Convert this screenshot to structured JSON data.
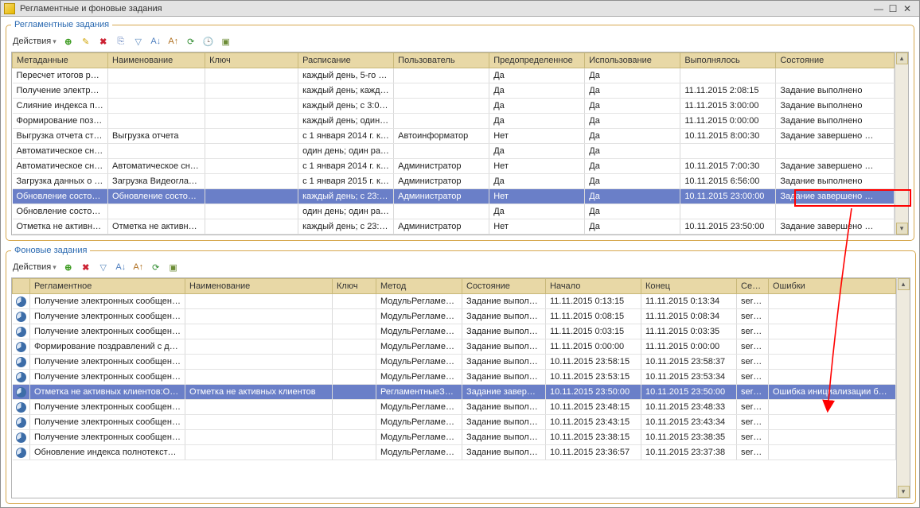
{
  "window": {
    "title": "Регламентные и фоновые задания"
  },
  "panel1": {
    "legend": "Регламентные задания",
    "actions_label": "Действия",
    "headers": [
      "Метаданные",
      "Наименование",
      "Ключ",
      "Расписание",
      "Пользователь",
      "Предопределенное",
      "Использование",
      "Выполнялось",
      "Состояние"
    ],
    "rows": [
      {
        "c": [
          "Пересчет итогов ре…",
          "",
          "",
          "каждый  день, 5-го ч…",
          "",
          "Да",
          "Да",
          "",
          ""
        ]
      },
      {
        "c": [
          "Получение электро…",
          "",
          "",
          "каждый  день; кажд…",
          "",
          "Да",
          "Да",
          "11.11.2015 2:08:15",
          "Задание выполнено"
        ]
      },
      {
        "c": [
          "Слияние индекса по…",
          "",
          "",
          "каждый  день; с 3:0…",
          "",
          "Да",
          "Да",
          "11.11.2015 3:00:00",
          "Задание выполнено"
        ]
      },
      {
        "c": [
          "Формирование поз…",
          "",
          "",
          "каждый  день; один …",
          "",
          "Да",
          "Да",
          "11.11.2015 0:00:00",
          "Задание выполнено"
        ]
      },
      {
        "c": [
          "Выгрузка отчета ст…",
          "Выгрузка отчета",
          "",
          "с 1 января 2014 г. к…",
          "Автоинформатор",
          "Нет",
          "Да",
          "10.11.2015 8:00:30",
          "Задание завершено …"
        ]
      },
      {
        "c": [
          "Автоматическое сн…",
          "",
          "",
          "один день; один раз…",
          "",
          "Да",
          "Да",
          "",
          ""
        ]
      },
      {
        "c": [
          "Автоматическое сн…",
          "Автоматическое сня…",
          "",
          "с 1 января 2014 г. к…",
          "Администратор",
          "Нет",
          "Да",
          "10.11.2015 7:00:30",
          "Задание завершено …"
        ]
      },
      {
        "c": [
          "Загрузка данных о …",
          "Загрузка Видеоглаз…",
          "",
          "с 1 января 2015 г. к…",
          "Администратор",
          "Да",
          "Да",
          "10.11.2015 6:56:00",
          "Задание выполнено"
        ]
      },
      {
        "c": [
          "Обновление состоя…",
          "Обновление состоян…",
          "",
          "каждый  день; с 23:…",
          "Администратор",
          "Нет",
          "Да",
          "10.11.2015 23:00:00",
          "Задание завершено …"
        ],
        "sel": true
      },
      {
        "c": [
          "Обновление состоя…",
          "",
          "",
          "один день; один раз…",
          "",
          "Да",
          "Да",
          "",
          ""
        ]
      },
      {
        "c": [
          "Отметка не активн…",
          "Отметка не активны…",
          "",
          "каждый  день; с 23:…",
          "Администратор",
          "Нет",
          "Да",
          "10.11.2015 23:50:00",
          "Задание завершено …"
        ]
      }
    ]
  },
  "panel2": {
    "legend": "Фоновые задания",
    "actions_label": "Действия",
    "headers": [
      "",
      "Регламентное",
      "Наименование",
      "Ключ",
      "Метод",
      "Состояние",
      "Начало",
      "Конец",
      "Сер…",
      "Ошибки"
    ],
    "rows": [
      {
        "c": [
          "",
          "Получение электронных сообщений",
          "",
          "",
          "МодульРегламен…",
          "Задание выполне…",
          "11.11.2015 0:13:15",
          "11.11.2015 0:13:34",
          "serv…",
          ""
        ]
      },
      {
        "c": [
          "",
          "Получение электронных сообщений",
          "",
          "",
          "МодульРегламен…",
          "Задание выполне…",
          "11.11.2015 0:08:15",
          "11.11.2015 0:08:34",
          "serv…",
          ""
        ]
      },
      {
        "c": [
          "",
          "Получение электронных сообщений",
          "",
          "",
          "МодульРегламен…",
          "Задание выполне…",
          "11.11.2015 0:03:15",
          "11.11.2015 0:03:35",
          "serv…",
          ""
        ]
      },
      {
        "c": [
          "",
          "Формирование поздравлений с дн…",
          "",
          "",
          "МодульРегламен…",
          "Задание выполне…",
          "11.11.2015 0:00:00",
          "11.11.2015 0:00:00",
          "serv…",
          ""
        ]
      },
      {
        "c": [
          "",
          "Получение электронных сообщений",
          "",
          "",
          "МодульРегламен…",
          "Задание выполне…",
          "10.11.2015 23:58:15",
          "10.11.2015 23:58:37",
          "serv…",
          ""
        ]
      },
      {
        "c": [
          "",
          "Получение электронных сообщений",
          "",
          "",
          "МодульРегламен…",
          "Задание выполне…",
          "10.11.2015 23:53:15",
          "10.11.2015 23:53:34",
          "serv…",
          ""
        ]
      },
      {
        "c": [
          "",
          "Отметка не активных клиентов:От…",
          "Отметка не активных клиентов",
          "",
          "РегламентныеЗа…",
          "Задание заверш…",
          "10.11.2015 23:50:00",
          "10.11.2015 23:50:00",
          "serv…",
          "Ошибка инициализации библи…"
        ],
        "sel": true
      },
      {
        "c": [
          "",
          "Получение электронных сообщений",
          "",
          "",
          "МодульРегламен…",
          "Задание выполне…",
          "10.11.2015 23:48:15",
          "10.11.2015 23:48:33",
          "serv…",
          ""
        ]
      },
      {
        "c": [
          "",
          "Получение электронных сообщений",
          "",
          "",
          "МодульРегламен…",
          "Задание выполне…",
          "10.11.2015 23:43:15",
          "10.11.2015 23:43:34",
          "serv…",
          ""
        ]
      },
      {
        "c": [
          "",
          "Получение электронных сообщений",
          "",
          "",
          "МодульРегламен…",
          "Задание выполне…",
          "10.11.2015 23:38:15",
          "10.11.2015 23:38:35",
          "serv…",
          ""
        ]
      },
      {
        "c": [
          "",
          "Обновление индекса полнотексто…",
          "",
          "",
          "МодульРегламен…",
          "Задание выполне…",
          "10.11.2015 23:36:57",
          "10.11.2015 23:37:38",
          "serv…",
          ""
        ]
      }
    ]
  }
}
